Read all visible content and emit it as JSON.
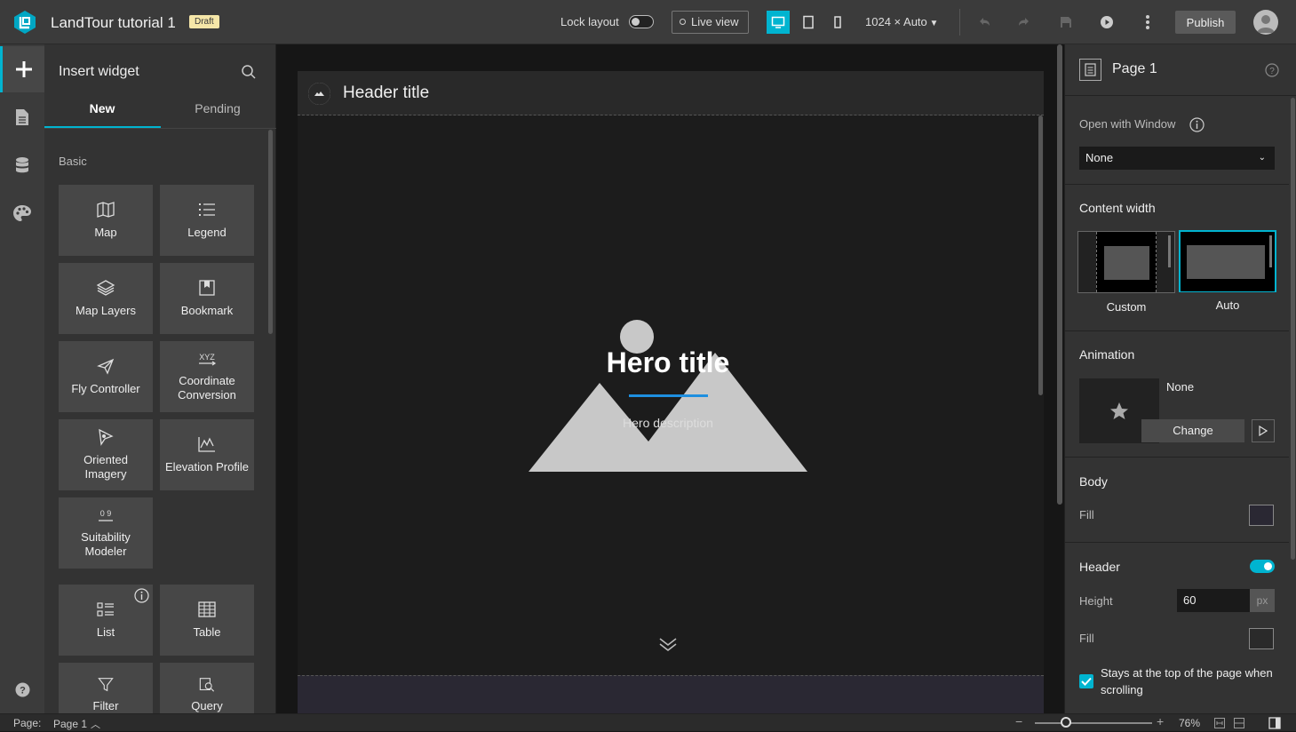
{
  "app": {
    "title": "LandTour tutorial 1",
    "status_badge": "Draft"
  },
  "toolbar": {
    "lock_layout_label": "Lock layout",
    "lock_layout_on": false,
    "live_view_label": "Live view",
    "resolution": "1024 × Auto",
    "publish_label": "Publish",
    "active_device": "desktop"
  },
  "left_rail": {
    "items": [
      "add-icon",
      "page-icon",
      "data-icon",
      "theme-icon"
    ],
    "help_icon": "help-icon"
  },
  "insert_panel": {
    "title": "Insert widget",
    "tabs": [
      {
        "label": "New",
        "active": true
      },
      {
        "label": "Pending",
        "active": false
      }
    ],
    "section": "Basic",
    "widgets": [
      {
        "label": "Map",
        "icon": "map-icon"
      },
      {
        "label": "Legend",
        "icon": "legend-icon"
      },
      {
        "label": "Map Layers",
        "icon": "layers-icon"
      },
      {
        "label": "Bookmark",
        "icon": "bookmark-icon"
      },
      {
        "label": "Fly Controller",
        "icon": "fly-icon"
      },
      {
        "label": "Coordinate Conversion",
        "icon": "coordinate-icon"
      },
      {
        "label": "Oriented Imagery",
        "icon": "oriented-imagery-icon"
      },
      {
        "label": "Elevation Profile",
        "icon": "elevation-icon"
      },
      {
        "label": "Suitability Modeler",
        "icon": "suitability-icon"
      },
      {
        "label": "List",
        "icon": "list-icon"
      },
      {
        "label": "Table",
        "icon": "table-icon"
      },
      {
        "label": "Filter",
        "icon": "filter-icon"
      },
      {
        "label": "Query",
        "icon": "query-icon"
      }
    ]
  },
  "canvas": {
    "header_title": "Header title",
    "hero_title": "Hero title",
    "hero_description": "Hero description",
    "accent_color": "#1e8fe0"
  },
  "right_panel": {
    "page_title": "Page 1",
    "open_with_window_label": "Open with Window",
    "open_with_window_value": "None",
    "content_width_label": "Content width",
    "content_width_options": [
      {
        "label": "Custom",
        "selected": false
      },
      {
        "label": "Auto",
        "selected": true
      }
    ],
    "animation_label": "Animation",
    "animation_value": "None",
    "change_label": "Change",
    "body_label": "Body",
    "body_fill_label": "Fill",
    "body_fill_color": "#2a2833",
    "header_label": "Header",
    "header_enabled": true,
    "height_label": "Height",
    "height_value": "60",
    "height_unit": "px",
    "header_fill_label": "Fill",
    "header_fill_color": "#2a2a2a",
    "sticky_label": "Stays at the top of the page when scrolling",
    "sticky_checked": true
  },
  "status_bar": {
    "page_label": "Page:",
    "page_value": "Page 1",
    "zoom": "76%",
    "zoom_level": 0.76
  }
}
